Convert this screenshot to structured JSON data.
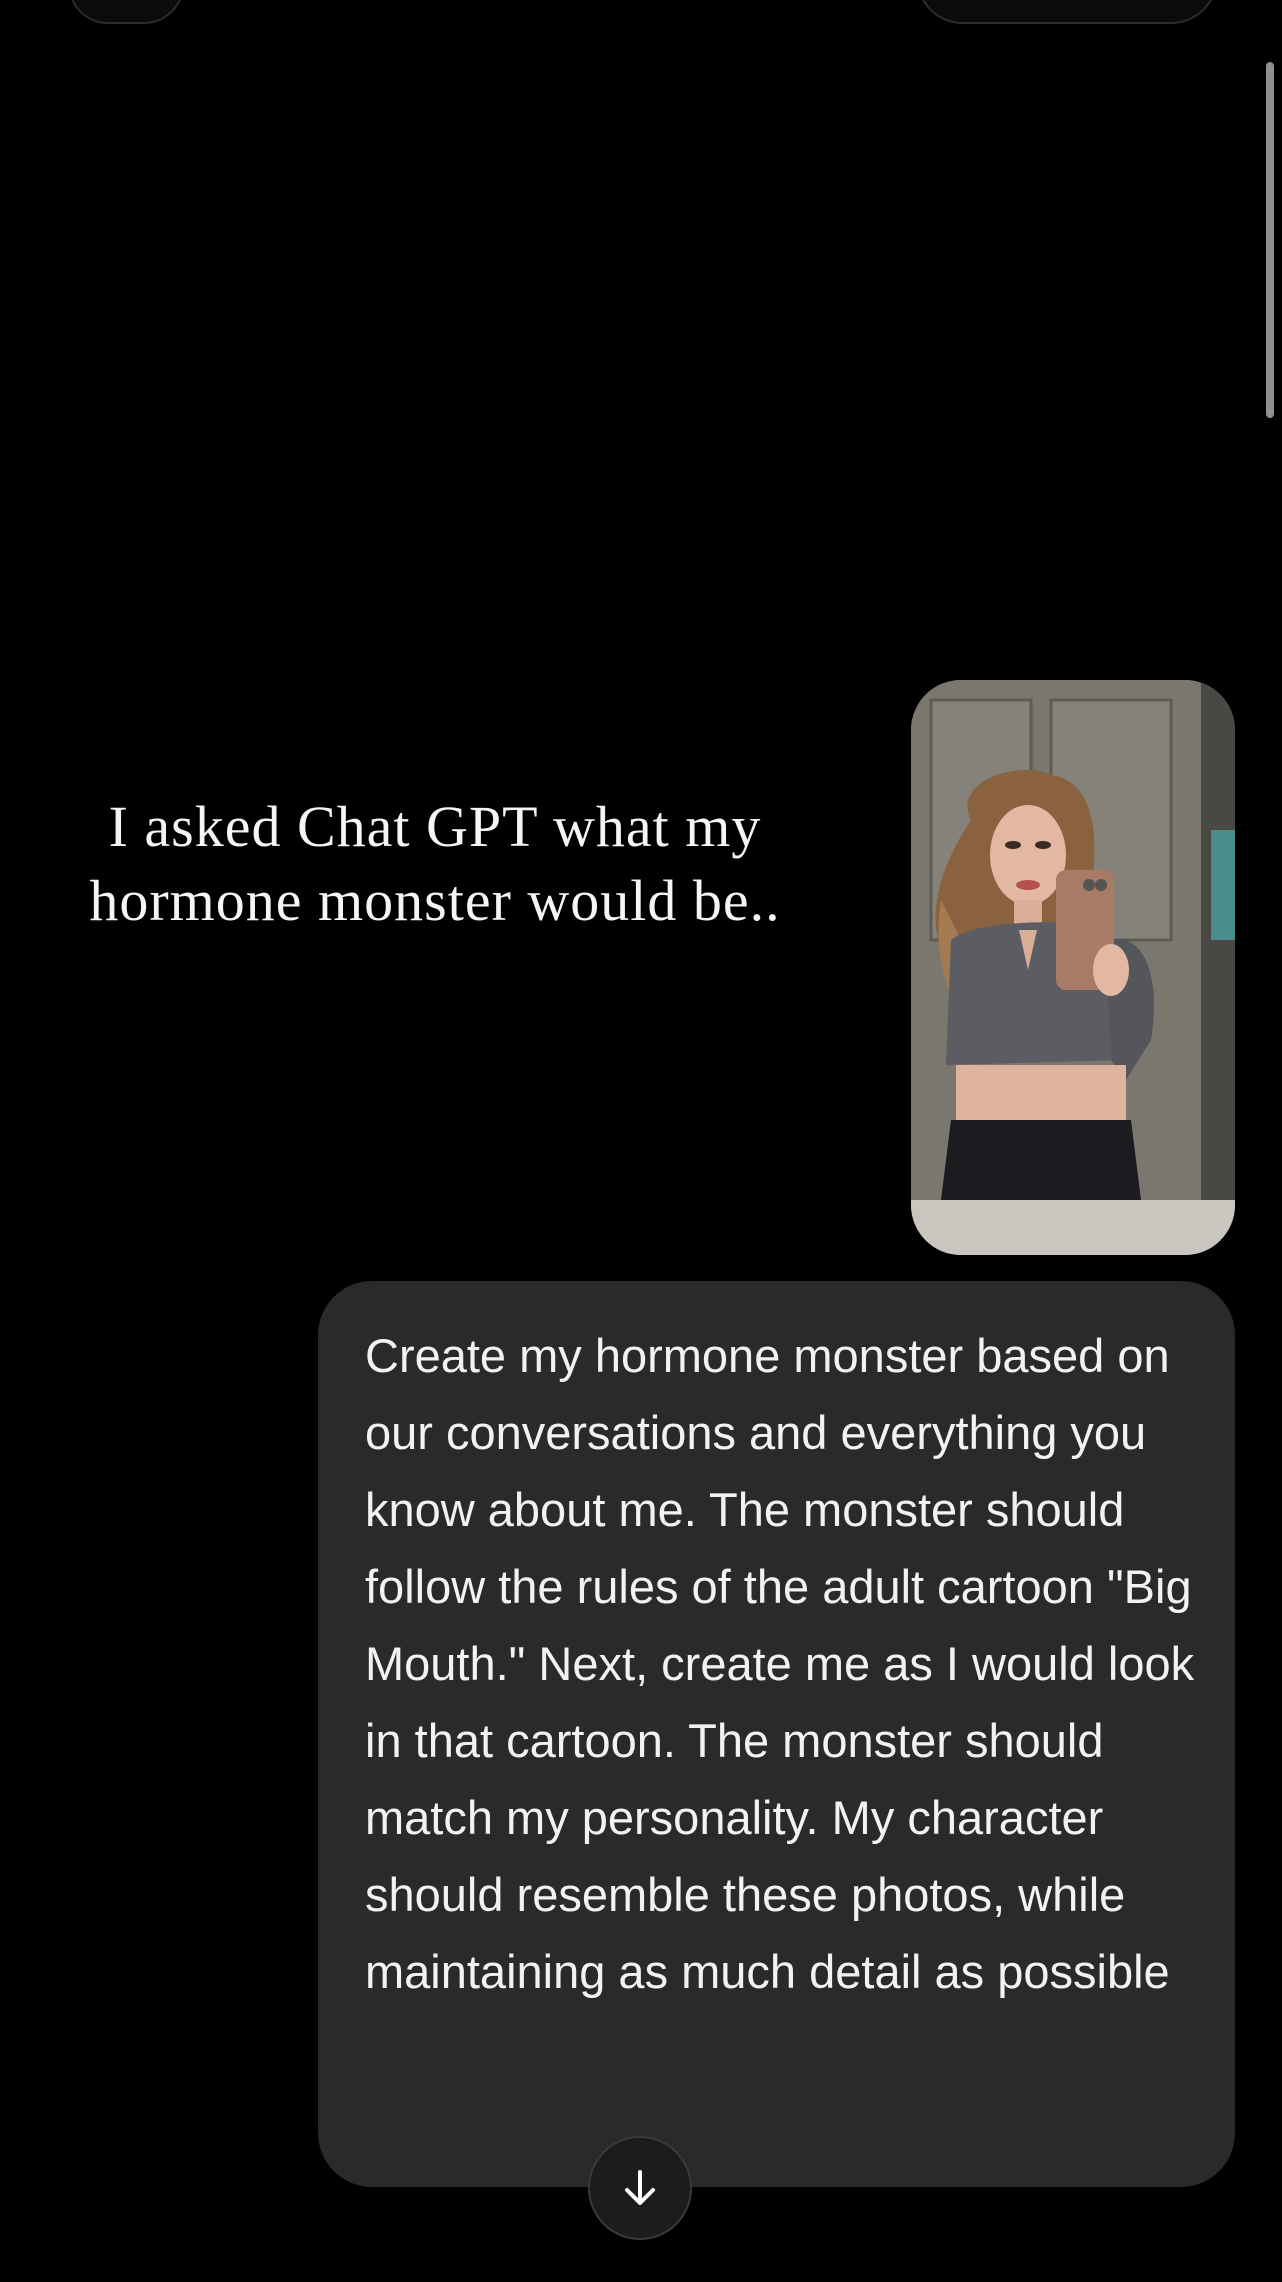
{
  "caption": {
    "text": "I asked Chat GPT what my hormone monster would be.."
  },
  "message": {
    "text": "Create my hormone monster based on our conversations and everything you know about me. The monster should follow the rules of the adult cartoon \"Big Mouth.\" Next, create me as I would look in that cartoon. The monster should match my personality. My character should resemble these photos, while maintaining as much detail as possible"
  },
  "photo": {
    "description_icon": "image-attachment"
  },
  "controls": {
    "scroll_down_icon": "arrow-down-icon"
  },
  "colors": {
    "background": "#000000",
    "bubble": "#2a2a2c",
    "text": "#f2f2f2"
  }
}
